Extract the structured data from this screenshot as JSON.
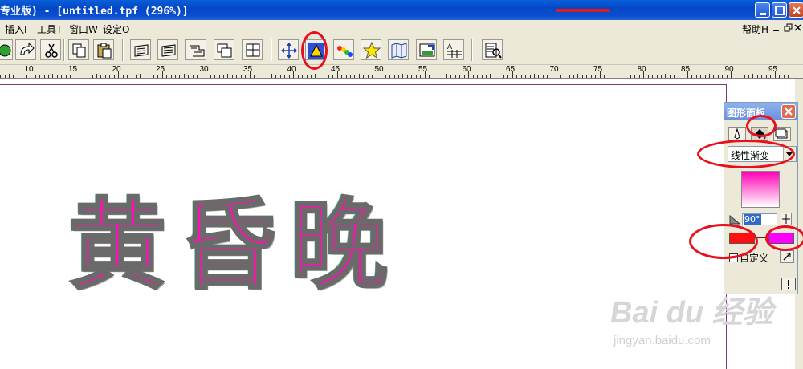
{
  "window": {
    "title": "专业版) - [untitled.tpf (296%)]"
  },
  "menubar": {
    "items": [
      "插入I",
      "工具T",
      "窗口W",
      "设定O"
    ],
    "help": "帮助H"
  },
  "toolbar": {
    "icons": [
      "new-icon",
      "redo-icon",
      "cut-icon",
      "copy-icon",
      "paste-icon",
      "frame-icon",
      "align-icon",
      "transform-icon",
      "layers-icon",
      "group-icon",
      "move-icon",
      "figure-fill-icon",
      "color-icon",
      "star-icon",
      "map-icon",
      "image-icon",
      "text-grid-icon",
      "preview-icon"
    ]
  },
  "ruler": {
    "labels": [
      "10",
      "15",
      "20",
      "25",
      "30",
      "35",
      "40",
      "45",
      "50",
      "55",
      "60",
      "65",
      "70",
      "75",
      "80",
      "85",
      "90",
      "95"
    ]
  },
  "artwork": {
    "text": "黄昏晚"
  },
  "panel": {
    "title": "图形面板",
    "gradient_type": "线性渐变",
    "angle": "90°",
    "custom_label": "自定义",
    "start_color": "#ff1010",
    "end_color": "#ff00ff",
    "preview_top_color": "#ff00b4"
  },
  "watermark": {
    "logo": "Bai du 经验",
    "url": "jingyan.baidu.com"
  }
}
